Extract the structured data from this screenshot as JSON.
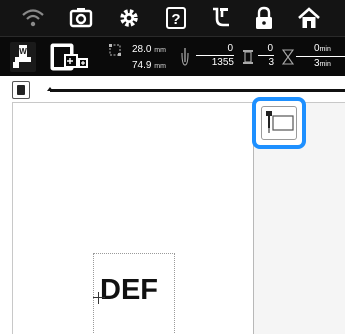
{
  "topbar": {
    "icons": [
      "wifi-icon",
      "camera-icon",
      "gear-icon",
      "help-icon",
      "stitch-guide-icon",
      "lock-icon",
      "home-icon"
    ]
  },
  "info": {
    "width_value": "28.0",
    "height_value": "74.9",
    "unit_mm": "mm",
    "stitch_count_current": "0",
    "stitch_count_total": "1355",
    "color_current": "0",
    "color_total": "3",
    "time_current": "0",
    "time_total": "3",
    "time_unit": "min"
  },
  "pattern": {
    "text": "DEF"
  },
  "progress": {
    "fraction": 0.0
  },
  "colors": {
    "accent": "#1e90ff",
    "topbar_bg": "#141414",
    "infobar_bg": "#0a0a0a"
  }
}
